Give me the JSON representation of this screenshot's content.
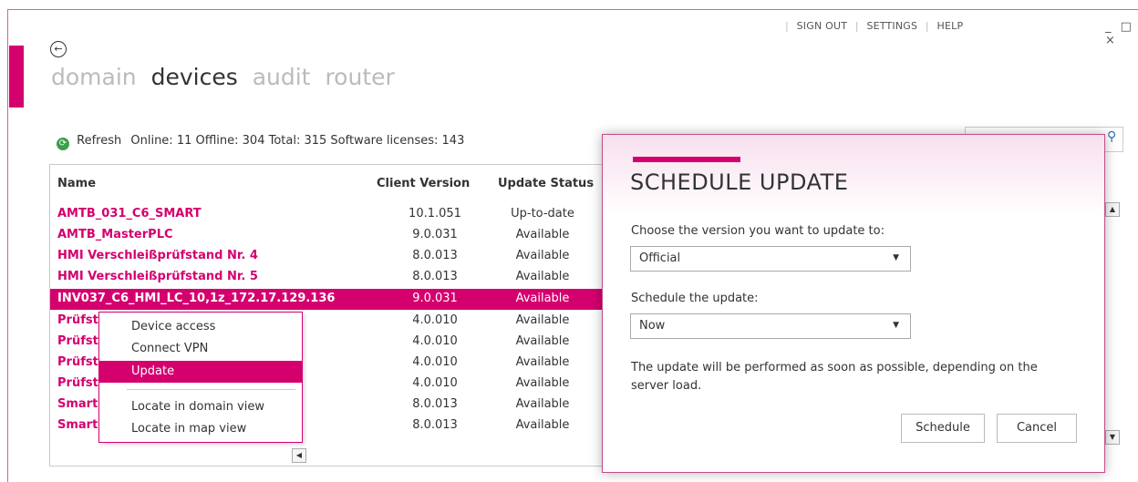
{
  "header": {
    "links": [
      "SIGN OUT",
      "SETTINGS",
      "HELP"
    ],
    "window_controls": "_ □ ×"
  },
  "nav": {
    "back_icon": "back-arrow-icon",
    "tabs": [
      {
        "label": "domain",
        "active": false
      },
      {
        "label": "devices",
        "active": true
      },
      {
        "label": "audit",
        "active": false
      },
      {
        "label": "router",
        "active": false
      }
    ]
  },
  "toolbar": {
    "refresh_label": "Refresh",
    "stats": "Online: 11  Offline: 304  Total: 315  Software licenses: 143"
  },
  "table": {
    "headers": {
      "name": "Name",
      "version": "Client Version",
      "status": "Update Status"
    },
    "rows": [
      {
        "name": "AMTB_031_C6_SMART",
        "version": "10.1.051",
        "status": "Up-to-date"
      },
      {
        "name": "AMTB_MasterPLC",
        "version": "9.0.031",
        "status": "Available"
      },
      {
        "name": "HMI Verschleißprüfstand Nr. 4",
        "version": "8.0.013",
        "status": "Available"
      },
      {
        "name": "HMI Verschleißprüfstand Nr. 5",
        "version": "8.0.013",
        "status": "Available"
      },
      {
        "name": "INV037_C6_HMI_LC_10,1z_172.17.129.136",
        "version": "9.0.031",
        "status": "Available",
        "selected": true
      },
      {
        "name": "Prüfst",
        "version": "4.0.010",
        "status": "Available"
      },
      {
        "name": "Prüfst",
        "version": "4.0.010",
        "status": "Available"
      },
      {
        "name": "Prüfst",
        "version": "4.0.010",
        "status": "Available"
      },
      {
        "name": "Prüfst",
        "version": "4.0.010",
        "status": "Available"
      },
      {
        "name": "Smart",
        "version": "8.0.013",
        "status": "Available"
      },
      {
        "name": "Smart",
        "version": "8.0.013",
        "status": "Available"
      }
    ]
  },
  "context_menu": {
    "items": [
      "Device access",
      "Connect VPN",
      "Update",
      "Locate in domain view",
      "Locate in map view"
    ],
    "active": "Update"
  },
  "dialog": {
    "title": "SCHEDULE UPDATE",
    "version_label": "Choose the version you want to update to:",
    "version_value": "Official",
    "schedule_label": "Schedule the update:",
    "schedule_value": "Now",
    "note": "The update will be performed as soon as possible, depending on the server load.",
    "schedule_button": "Schedule",
    "cancel_button": "Cancel"
  },
  "colors": {
    "accent": "#d4006e"
  }
}
